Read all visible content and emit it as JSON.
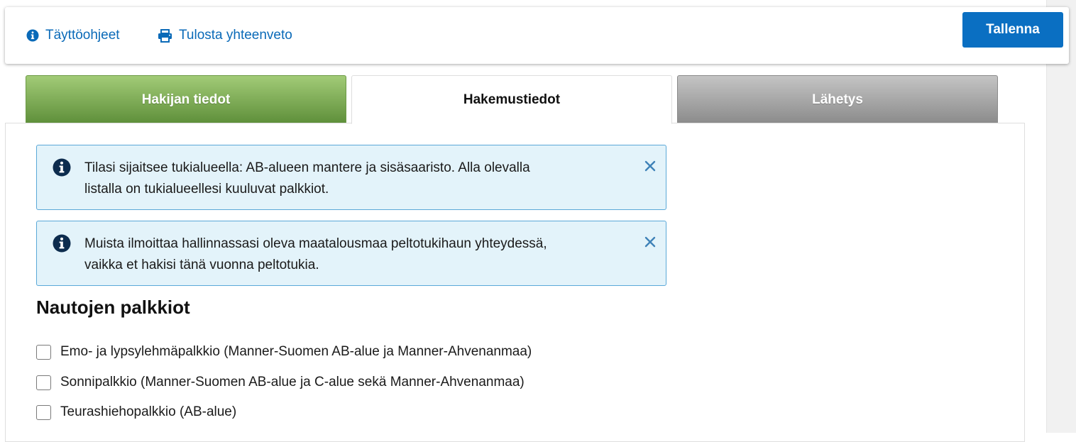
{
  "toolbar": {
    "help_label": "Täyttöohjeet",
    "print_label": "Tulosta yhteenveto",
    "save_label": "Tallenna"
  },
  "tabs": [
    {
      "label": "Hakijan tiedot",
      "state": "completed"
    },
    {
      "label": "Hakemustiedot",
      "state": "active"
    },
    {
      "label": "Lähetys",
      "state": "disabled"
    }
  ],
  "alerts": [
    {
      "line1": "Tilasi sijaitsee tukialueella: AB-alueen mantere ja sisäsaaristo. Alla olevalla",
      "line2": "listalla on tukialueellesi kuuluvat palkkiot."
    },
    {
      "line1": "Muista ilmoittaa hallinnassasi oleva maatalousmaa peltotukihaun yhteydessä,",
      "line2": "vaikka et hakisi tänä vuonna peltotukia."
    }
  ],
  "section": {
    "title": "Nautojen palkkiot",
    "options": [
      {
        "label": "Emo- ja lypsylehmäpalkkio (Manner-Suomen AB-alue ja Manner-Ahvenanmaa)",
        "checked": false
      },
      {
        "label": "Sonnipalkkio (Manner-Suomen AB-alue ja C-alue sekä Manner-Ahvenanmaa)",
        "checked": false
      },
      {
        "label": "Teurashiehopalkkio (AB-alue)",
        "checked": false
      }
    ]
  },
  "colors": {
    "link": "#0a6ab8",
    "primary_button": "#0a6fc2",
    "tab_completed": "#6b9a45",
    "tab_disabled": "#9e9e9e",
    "alert_bg": "#e3f3fa",
    "alert_border": "#5aa8d8",
    "info_icon": "#0d2c4e"
  },
  "icons": [
    "info-circle-icon",
    "printer-icon",
    "close-icon"
  ]
}
